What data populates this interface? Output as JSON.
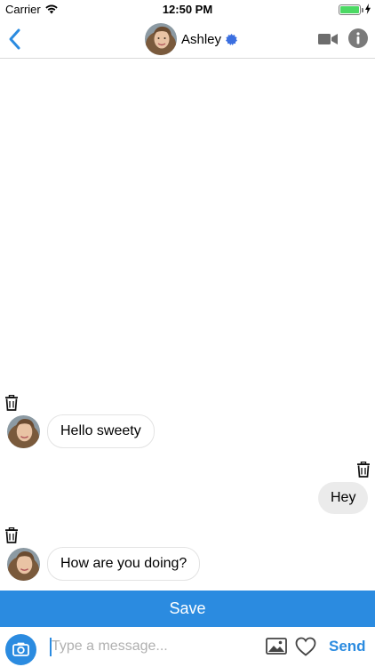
{
  "status_bar": {
    "carrier": "Carrier",
    "time": "12:50 PM",
    "battery_level": 1.0,
    "battery_color": "#4cd964"
  },
  "header": {
    "back_icon": "chevron-left-icon",
    "contact_name": "Ashley",
    "verified_icon": "verified-badge-icon",
    "video_icon": "video-camera-icon",
    "info_icon": "info-icon"
  },
  "messages": [
    {
      "direction": "incoming",
      "text": "Hello sweety",
      "delete_icon": "trash-icon"
    },
    {
      "direction": "outgoing",
      "text": "Hey",
      "delete_icon": "trash-icon"
    },
    {
      "direction": "incoming",
      "text": "How are you doing?",
      "delete_icon": "trash-icon"
    }
  ],
  "save_label": "Save",
  "composer": {
    "camera_icon": "camera-icon",
    "placeholder": "Type a message...",
    "value": "",
    "image_icon": "image-icon",
    "heart_icon": "heart-icon",
    "send_label": "Send"
  },
  "colors": {
    "accent": "#2b8be0",
    "verified": "#3b6fe0",
    "outgoing_bubble": "#ebebeb",
    "incoming_bubble": "#ffffff"
  }
}
